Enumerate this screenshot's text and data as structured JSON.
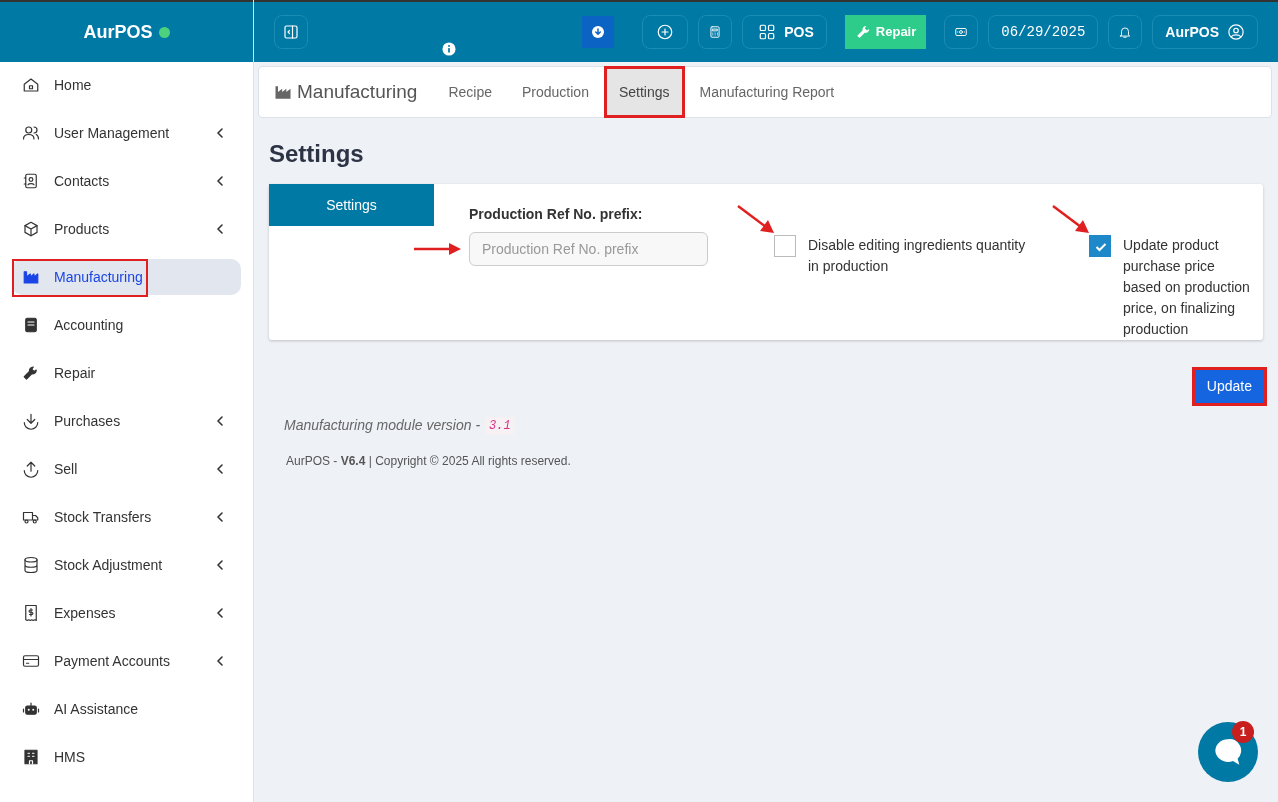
{
  "brand": {
    "name": "AurPOS",
    "online": true
  },
  "topbar": {
    "pos_label": "POS",
    "repair_label": "Repair",
    "date": "06/29/2025",
    "user": "AurPOS"
  },
  "sidebar": {
    "items": [
      {
        "label": "Home",
        "selected": false,
        "has_submenu": false,
        "highlighted": false
      },
      {
        "label": "User Management",
        "selected": false,
        "has_submenu": true,
        "highlighted": false
      },
      {
        "label": "Contacts",
        "selected": false,
        "has_submenu": true,
        "highlighted": false
      },
      {
        "label": "Products",
        "selected": false,
        "has_submenu": true,
        "highlighted": false
      },
      {
        "label": "Manufacturing",
        "selected": true,
        "has_submenu": false,
        "highlighted": true
      },
      {
        "label": "Accounting",
        "selected": false,
        "has_submenu": false,
        "highlighted": false
      },
      {
        "label": "Repair",
        "selected": false,
        "has_submenu": false,
        "highlighted": false
      },
      {
        "label": "Purchases",
        "selected": false,
        "has_submenu": true,
        "highlighted": false
      },
      {
        "label": "Sell",
        "selected": false,
        "has_submenu": true,
        "highlighted": false
      },
      {
        "label": "Stock Transfers",
        "selected": false,
        "has_submenu": true,
        "highlighted": false
      },
      {
        "label": "Stock Adjustment",
        "selected": false,
        "has_submenu": true,
        "highlighted": false
      },
      {
        "label": "Expenses",
        "selected": false,
        "has_submenu": true,
        "highlighted": false
      },
      {
        "label": "Payment Accounts",
        "selected": false,
        "has_submenu": true,
        "highlighted": false
      },
      {
        "label": "AI Assistance",
        "selected": false,
        "has_submenu": false,
        "highlighted": false
      },
      {
        "label": "HMS",
        "selected": false,
        "has_submenu": false,
        "highlighted": false
      }
    ]
  },
  "module": {
    "title": "Manufacturing",
    "tabs": [
      {
        "label": "Recipe",
        "selected": false,
        "highlighted": false
      },
      {
        "label": "Production",
        "selected": false,
        "highlighted": false
      },
      {
        "label": "Settings",
        "selected": true,
        "highlighted": true
      },
      {
        "label": "Manufacturing Report",
        "selected": false,
        "highlighted": false
      }
    ]
  },
  "page_title": "Settings",
  "settings_card": {
    "tab_label": "Settings",
    "prefix_label": "Production Ref No. prefix:",
    "prefix_placeholder": "Production Ref No. prefix",
    "prefix_arrow": true,
    "options": [
      {
        "label": "Disable editing ingredients quantity in production",
        "checked": false,
        "arrow": true
      },
      {
        "label": "Update product purchase price based on production price, on finalizing production",
        "checked": true,
        "arrow": true
      }
    ]
  },
  "update_button": {
    "label": "Update",
    "highlighted": true
  },
  "version": {
    "text": "Manufacturing module version -",
    "code": "3.1"
  },
  "footer": "AurPOS - **V6.4** | Copyright © 2025 All rights reserved.",
  "chat": {
    "badge": "1"
  }
}
